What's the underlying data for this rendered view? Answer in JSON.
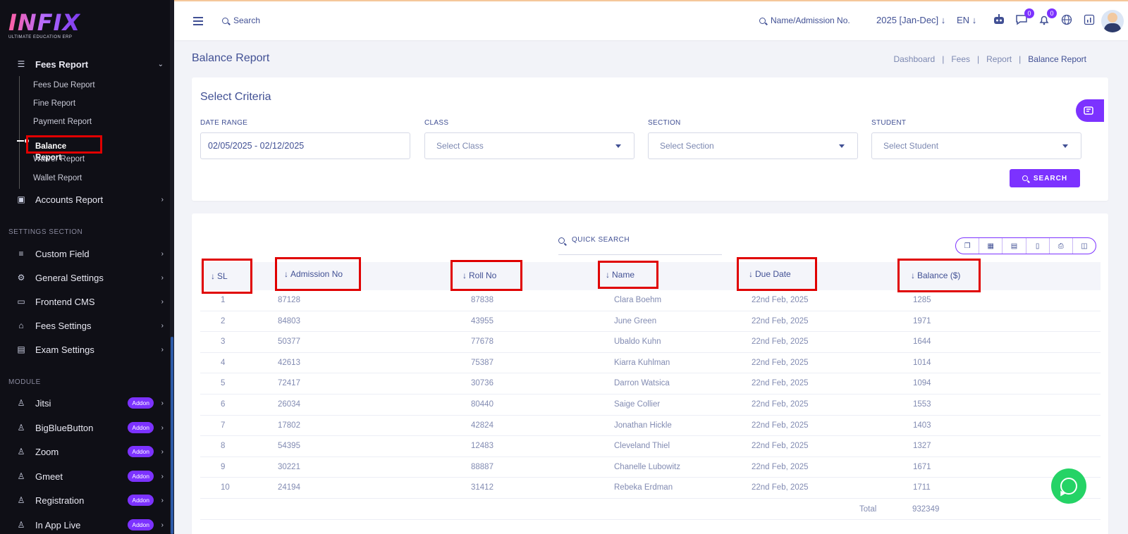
{
  "brand": {
    "logo": "INFIX",
    "tagline": "ULTIMATE EDUCATION ERP"
  },
  "sidebar": {
    "fees_report": {
      "label": "Fees Report",
      "icon": "server-icon"
    },
    "fees_report_items": [
      {
        "label": "Fees Due Report"
      },
      {
        "label": "Fine Report"
      },
      {
        "label": "Payment Report"
      },
      {
        "label": "Balance Report",
        "active": true
      },
      {
        "label": "Waiver Report"
      },
      {
        "label": "Wallet Report"
      }
    ],
    "accounts_report": {
      "label": "Accounts Report"
    },
    "settings_section_title": "SETTINGS SECTION",
    "settings_items": [
      {
        "label": "Custom Field"
      },
      {
        "label": "General Settings"
      },
      {
        "label": "Frontend CMS"
      },
      {
        "label": "Fees Settings"
      },
      {
        "label": "Exam Settings"
      }
    ],
    "module_title": "MODULE",
    "module_items": [
      {
        "label": "Jitsi",
        "badge": "Addon"
      },
      {
        "label": "BigBlueButton",
        "badge": "Addon"
      },
      {
        "label": "Zoom",
        "badge": "Addon"
      },
      {
        "label": "Gmeet",
        "badge": "Addon"
      },
      {
        "label": "Registration",
        "badge": "Addon"
      },
      {
        "label": "In App Live",
        "badge": "Addon"
      }
    ]
  },
  "topbar": {
    "search_placeholder": "Search",
    "name_search": "Name/Admission No.",
    "session": "2025 [Jan-Dec]",
    "session_arrow": "↓",
    "language": "EN",
    "language_arrow": "↓",
    "messages_count": "0",
    "notifications_count": "0"
  },
  "page": {
    "title": "Balance Report",
    "breadcrumb": [
      "Dashboard",
      "Fees",
      "Report",
      "Balance Report"
    ],
    "breadcrumb_sep": "|"
  },
  "criteria": {
    "title": "Select Criteria",
    "date_range_label": "DATE RANGE",
    "date_range_value": "02/05/2025 - 02/12/2025",
    "class_label": "CLASS",
    "class_value": "Select Class",
    "section_label": "SECTION",
    "section_value": "Select Section",
    "student_label": "STUDENT",
    "student_value": "Select Student",
    "search_button": "SEARCH"
  },
  "table": {
    "quick_search": "QUICK SEARCH",
    "sort_arrow": "↓",
    "columns": [
      "SL",
      "Admission No",
      "Roll No",
      "Name",
      "Due Date",
      "Balance ($)"
    ],
    "rows": [
      [
        "1",
        "87128",
        "87838",
        "Clara Boehm",
        "22nd Feb, 2025",
        "1285"
      ],
      [
        "2",
        "84803",
        "43955",
        "June Green",
        "22nd Feb, 2025",
        "1971"
      ],
      [
        "3",
        "50377",
        "77678",
        "Ubaldo Kuhn",
        "22nd Feb, 2025",
        "1644"
      ],
      [
        "4",
        "42613",
        "75387",
        "Kiarra Kuhlman",
        "22nd Feb, 2025",
        "1014"
      ],
      [
        "5",
        "72417",
        "30736",
        "Darron Watsica",
        "22nd Feb, 2025",
        "1094"
      ],
      [
        "6",
        "26034",
        "80440",
        "Saige Collier",
        "22nd Feb, 2025",
        "1553"
      ],
      [
        "7",
        "17802",
        "42824",
        "Jonathan Hickle",
        "22nd Feb, 2025",
        "1403"
      ],
      [
        "8",
        "54395",
        "12483",
        "Cleveland Thiel",
        "22nd Feb, 2025",
        "1327"
      ],
      [
        "9",
        "30221",
        "88887",
        "Chanelle Lubowitz",
        "22nd Feb, 2025",
        "1671"
      ],
      [
        "10",
        "24194",
        "31412",
        "Rebeka Erdman",
        "22nd Feb, 2025",
        "1711"
      ]
    ],
    "total_label": "Total",
    "total_value": "932349"
  },
  "colors": {
    "accent": "#7c32ff",
    "text": "#415094",
    "sidebar_bg": "#0f0f16",
    "highlight": "#e00000",
    "whatsapp": "#25d366"
  }
}
